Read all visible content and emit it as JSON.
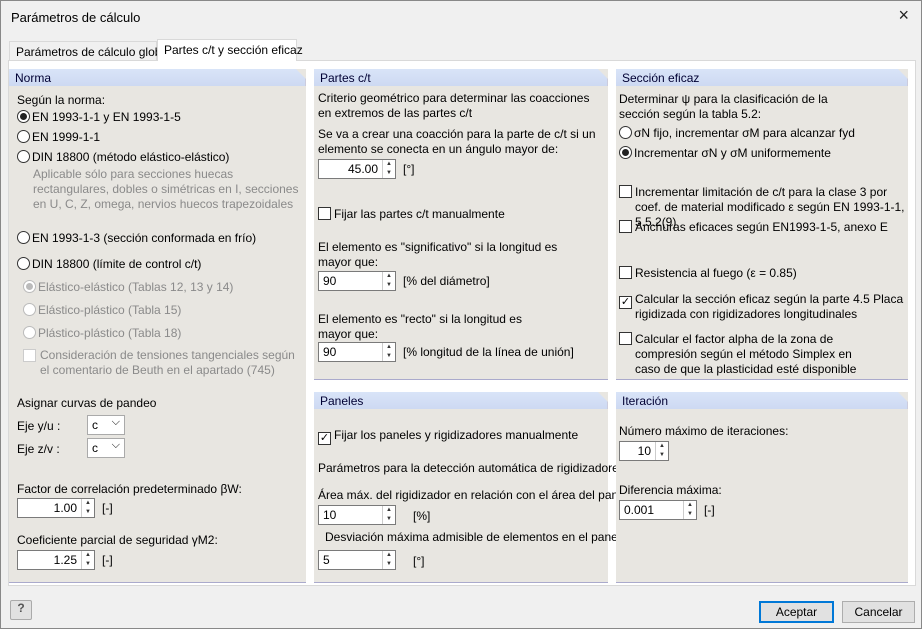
{
  "window": {
    "title": "Parámetros de cálculo",
    "close_icon": "×"
  },
  "tabs": [
    {
      "label": "Parámetros de cálculo global"
    },
    {
      "label": "Partes c/t y sección eficaz"
    }
  ],
  "norma": {
    "header": "Norma",
    "subtitle": "Según la norma:",
    "options": [
      "EN 1993-1-1 y EN 1993-1-5",
      "EN 1999-1-1",
      "DIN 18800 (método elástico-elástico)",
      "EN 1993-1-3 (sección conformada en frío)",
      "DIN 18800 (límite de control c/t)"
    ],
    "note": "Aplicable sólo para secciones huecas rectangulares, dobles o simétricas en I, secciones en U, C, Z, omega, nervios huecos trapezoidales",
    "sub_options": [
      "Elástico-elástico (Tablas 12, 13 y 14)",
      "Elástico-plástico (Tabla 15)",
      "Plástico-plástico (Tabla 18)"
    ],
    "beuth": "Consideración de tensiones tangenciales según el comentario de Beuth en el apartado (745)",
    "pandeo_label": "Asignar curvas de pandeo",
    "eje_y_label": "Eje y/u :",
    "eje_y_value": "c",
    "eje_z_label": "Eje z/v :",
    "eje_z_value": "c",
    "factor_label": "Factor de correlación predeterminado βW:",
    "factor_value": "1.00",
    "factor_unit": "[-]",
    "coef_label": "Coeficiente parcial de seguridad γM2:",
    "coef_value": "1.25",
    "coef_unit": "[-]"
  },
  "partes": {
    "header": "Partes c/t",
    "criterio": "Criterio geométrico para determinar las coacciones en extremos de las partes c/t",
    "angulo_label": "Se va a crear una coacción para la parte de c/t si un elemento se conecta en un ángulo mayor de:",
    "angulo_value": "45.00",
    "angulo_unit": "[°]",
    "fijar_label": "Fijar las partes c/t manualmente",
    "signif_label": "El elemento es \"significativo\" si la longitud es mayor que:",
    "signif_value": "90",
    "signif_unit": "[% del diámetro]",
    "recto_label": "El elemento es \"recto\" si la longitud es mayor que:",
    "recto_value": "90",
    "recto_unit": "[% longitud de la línea de unión]"
  },
  "paneles": {
    "header": "Paneles",
    "fijar_label": "Fijar los paneles y rigidizadores manualmente",
    "param_label": "Parámetros para la detección automática de rigidizadores:",
    "area_label": "Área máx. del rigidizador en relación con el área del panel:",
    "area_value": "10",
    "area_unit": "[%]",
    "desv_label": "Desviación máxima admisible de elementos en el panel:",
    "desv_value": "5",
    "desv_unit": "[°]"
  },
  "seccion": {
    "header": "Sección eficaz",
    "determinar": "Determinar ψ para la clasificación de la sección según la tabla 5.2:",
    "radio1": "σN fijo, incrementar σM para alcanzar fyd",
    "radio2": "Incrementar σN y σM uniformemente",
    "chk1": "Incrementar limitación de c/t para la clase 3 por coef. de material modificado ε según EN 1993-1-1, 5.5.2(9)",
    "chk2": "Anchuras eficaces según EN1993-1-5, anexo E",
    "chk3": "Resistencia al fuego (ε = 0.85)",
    "chk4": "Calcular la sección eficaz según la parte 4.5 Placa rigidizada con rigidizadores longitudinales",
    "chk5": "Calcular el factor alpha de la zona de compresión según el método Simplex en caso de que la plasticidad esté disponible"
  },
  "iteracion": {
    "header": "Iteración",
    "num_label": "Número máximo de iteraciones:",
    "num_value": "10",
    "dif_label": "Diferencia máxima:",
    "dif_value": "0.001",
    "dif_unit": "[-]"
  },
  "footer": {
    "help_icon": "?",
    "accept": "Aceptar",
    "cancel": "Cancelar"
  }
}
